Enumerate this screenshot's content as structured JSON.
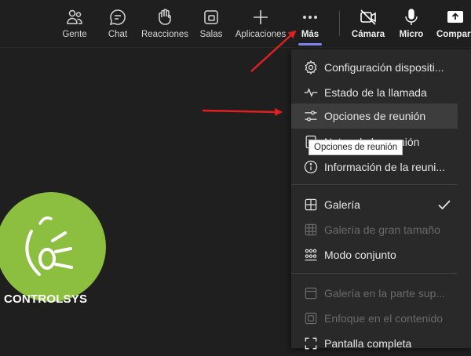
{
  "toolbar": {
    "items": [
      {
        "label": "Gente",
        "icon": "people-icon"
      },
      {
        "label": "Chat",
        "icon": "chat-icon"
      },
      {
        "label": "Reacciones",
        "icon": "raise-hand-icon"
      },
      {
        "label": "Salas",
        "icon": "breakout-rooms-icon"
      },
      {
        "label": "Aplicaciones",
        "icon": "plus-icon"
      },
      {
        "label": "Más",
        "icon": "more-dots-icon"
      },
      {
        "label": "Cámara",
        "icon": "camera-off-icon"
      },
      {
        "label": "Micro",
        "icon": "microphone-icon"
      },
      {
        "label": "Compart",
        "icon": "share-screen-icon"
      }
    ]
  },
  "menu": {
    "items": [
      {
        "label": "Configuración dispositi...",
        "icon": "gear-icon"
      },
      {
        "label": "Estado de la llamada",
        "icon": "pulse-icon"
      },
      {
        "label": "Opciones de reunión",
        "icon": "sliders-icon"
      },
      {
        "label": "Notas de la reunión",
        "icon": "notes-icon"
      },
      {
        "label": "Información de la reuni...",
        "icon": "info-icon"
      },
      {
        "label": "Galería",
        "icon": "grid-icon",
        "checked": true
      },
      {
        "label": "Galería de gran tamaño",
        "icon": "large-grid-icon",
        "disabled": true
      },
      {
        "label": "Modo conjunto",
        "icon": "together-mode-icon"
      },
      {
        "label": "Galería en la parte sup...",
        "icon": "top-gallery-icon",
        "disabled": true
      },
      {
        "label": "Enfoque en el contenido",
        "icon": "focus-icon",
        "disabled": true
      },
      {
        "label": "Pantalla completa",
        "icon": "fullscreen-icon"
      }
    ]
  },
  "tooltip": {
    "text": "Opciones de reunión"
  },
  "logo": {
    "text": "CONTROLSYS"
  },
  "colors": {
    "accent": "#7f85f5",
    "logo_green": "#8cbf3f",
    "arrow_red": "#e02020"
  }
}
